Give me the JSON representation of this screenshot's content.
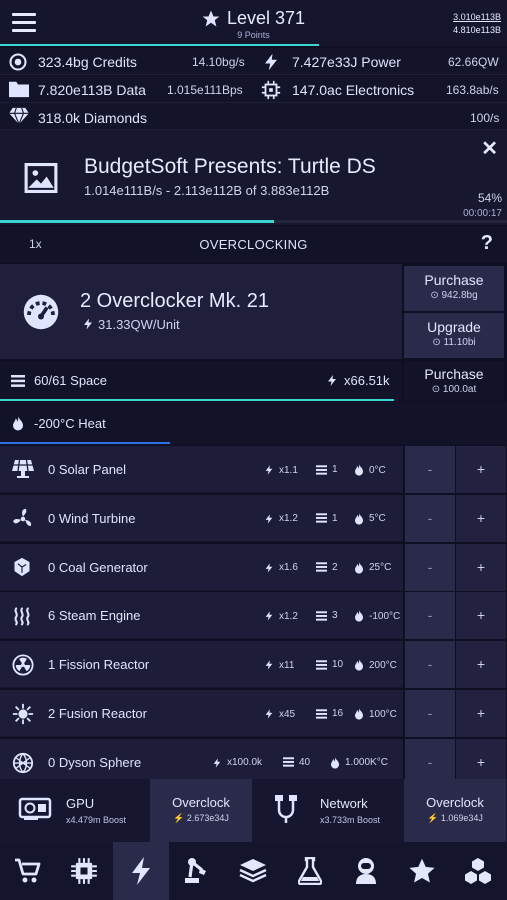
{
  "header": {
    "level": "Level 371",
    "points": "9 Points",
    "stat_top": "3.010e113B",
    "stat_bottom": "4.810e113B",
    "level_progress_fraction": 0.63
  },
  "resources": {
    "credits": {
      "value": "323.4bg Credits",
      "rate": "14.10bg/s",
      "icon": "coin-icon"
    },
    "power": {
      "value": "7.427e33J Power",
      "rate": "62.66QW",
      "icon": "bolt-icon"
    },
    "data": {
      "value": "7.820e113B Data",
      "rate": "1.015e111Bps",
      "icon": "folder-icon"
    },
    "electronics": {
      "value": "147.0ac Electronics",
      "rate": "163.8ab/s",
      "icon": "chip-icon"
    },
    "diamonds": {
      "value": "318.0k Diamonds",
      "rate": "100/s",
      "icon": "diamond-icon"
    }
  },
  "project": {
    "title": "BudgetSoft Presents: Turtle DS",
    "subtitle": "1.014e111B/s - 2.113e112B of 3.883e112B",
    "percent": "54%",
    "time": "00:00:17",
    "close": "✕",
    "progress_fraction": 0.54
  },
  "overclocking": {
    "multiplier": "1x",
    "title": "OVERCLOCKING",
    "help": "?"
  },
  "overclocker": {
    "name": "2 Overclocker Mk. 21",
    "rate": "31.33QW/Unit",
    "purchase_label": "Purchase",
    "purchase_cost": "942.8bg",
    "upgrade_label": "Upgrade",
    "upgrade_cost": "11.10bi"
  },
  "space": {
    "text": "60/61 Space",
    "multiplier": "x66.51k",
    "purchase_label": "Purchase",
    "purchase_cost": "100.0at",
    "fill_fraction": 0.98
  },
  "heat": {
    "text": "-200°C Heat",
    "fill_fraction": 0.34
  },
  "generators": [
    {
      "name": "0 Solar Panel",
      "mult": "x1.1",
      "space": "1",
      "heat": "0°C",
      "icon": "solar-panel-icon"
    },
    {
      "name": "0 Wind Turbine",
      "mult": "x1.2",
      "space": "1",
      "heat": "5°C",
      "icon": "wind-turbine-icon"
    },
    {
      "name": "0 Coal Generator",
      "mult": "x1.6",
      "space": "2",
      "heat": "25°C",
      "icon": "coal-icon"
    },
    {
      "name": "6 Steam Engine",
      "mult": "x1.2",
      "space": "3",
      "heat": "-100°C",
      "icon": "steam-icon"
    },
    {
      "name": "1 Fission Reactor",
      "mult": "x11",
      "space": "10",
      "heat": "200°C",
      "icon": "radiation-icon"
    },
    {
      "name": "2 Fusion Reactor",
      "mult": "x45",
      "space": "16",
      "heat": "100°C",
      "icon": "fusion-icon"
    },
    {
      "name": "0 Dyson Sphere",
      "mult": "x100.0k",
      "space": "40",
      "heat": "1.000K°C",
      "icon": "dyson-sphere-icon"
    }
  ],
  "controls": {
    "minus": "-",
    "plus": "+"
  },
  "bottom": {
    "gpu_label": "GPU",
    "gpu_boost": "x4.479m Boost",
    "gpu_btn": "Overclock",
    "gpu_cost": "2.673e34J",
    "net_label": "Network",
    "net_boost": "x3.733m Boost",
    "net_btn": "Overclock",
    "net_cost": "1.069e34J"
  },
  "nav": [
    "shop-icon",
    "cpu-icon",
    "power-icon",
    "robot-arm-icon",
    "layers-icon",
    "flask-icon",
    "astronaut-icon",
    "star-icon",
    "cubes-icon"
  ],
  "nav_active": 2,
  "colors": {
    "accent": "#3ad6cf",
    "heat_bar": "#2f6fe0",
    "background": "#0f0f24"
  }
}
